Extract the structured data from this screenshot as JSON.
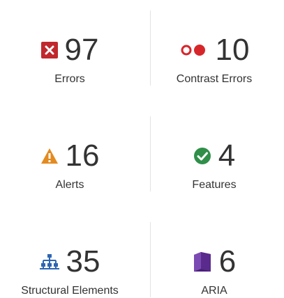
{
  "summary": {
    "errors": {
      "count": "97",
      "label": "Errors",
      "icon": "error-x-icon",
      "color": "#c0282d"
    },
    "contrast_errors": {
      "count": "10",
      "label": "Contrast Errors",
      "icon": "contrast-icon",
      "color": "#d7262a"
    },
    "alerts": {
      "count": "16",
      "label": "Alerts",
      "icon": "alert-triangle-icon",
      "color": "#e38a20"
    },
    "features": {
      "count": "4",
      "label": "Features",
      "icon": "check-circle-icon",
      "color": "#2f8f49"
    },
    "structural_elements": {
      "count": "35",
      "label": "Structural Elements",
      "icon": "hierarchy-icon",
      "color": "#2d65b3"
    },
    "aria": {
      "count": "6",
      "label": "ARIA",
      "icon": "aria-cube-icon",
      "color": "#5a2a8c"
    }
  }
}
